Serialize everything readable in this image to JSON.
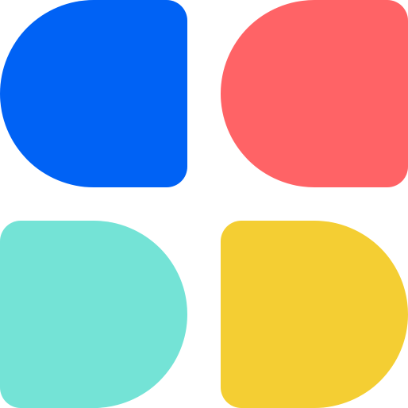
{
  "logo": {
    "tiles": [
      {
        "id": "top-left",
        "color": "#0062F5"
      },
      {
        "id": "top-right",
        "color": "#FF6366"
      },
      {
        "id": "bottom-left",
        "color": "#74E3D6"
      },
      {
        "id": "bottom-right",
        "color": "#F4CE33"
      }
    ]
  }
}
